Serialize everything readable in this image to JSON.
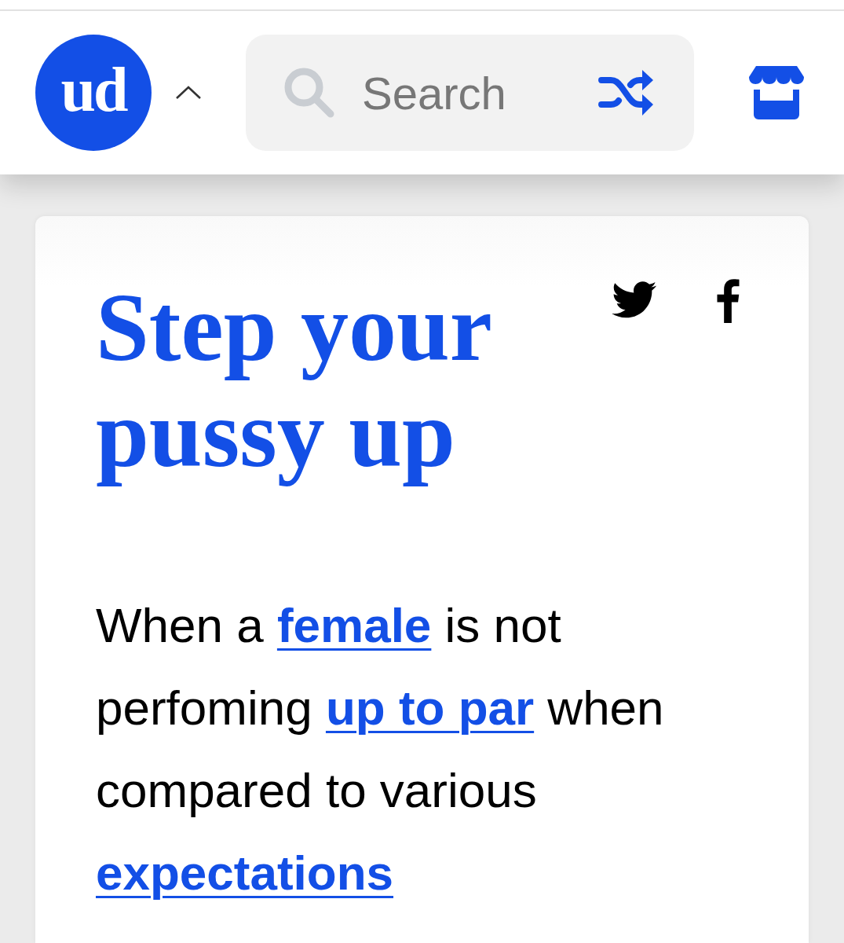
{
  "header": {
    "logo": {
      "text": "ud"
    },
    "search": {
      "placeholder": "Search"
    }
  },
  "definition": {
    "word": "Step your pussy up",
    "meaning": [
      {
        "kind": "text",
        "text": "When a "
      },
      {
        "kind": "link",
        "text": "female"
      },
      {
        "kind": "text",
        "text": " is not perfoming "
      },
      {
        "kind": "link",
        "text": "up to par"
      },
      {
        "kind": "text",
        "text": " when compared to various "
      },
      {
        "kind": "link",
        "text": "expectations"
      }
    ]
  }
}
